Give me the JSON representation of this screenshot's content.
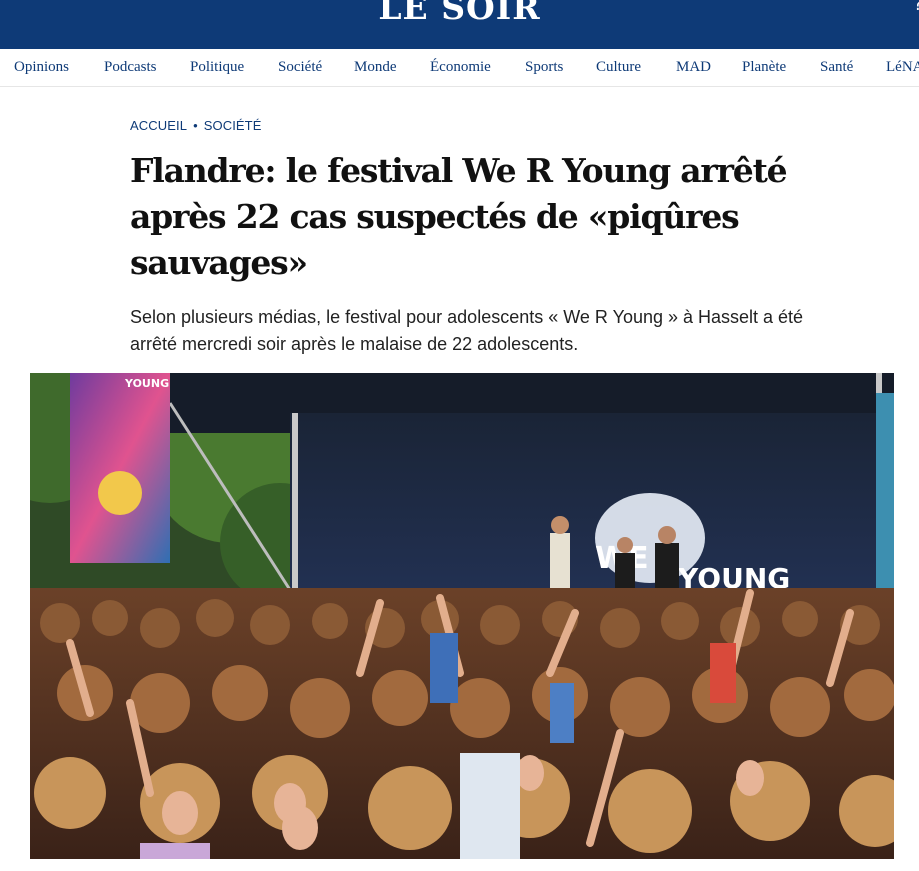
{
  "header": {
    "logo": "LE SOIR"
  },
  "nav": {
    "items": [
      "Opinions",
      "Podcasts",
      "Politique",
      "Société",
      "Monde",
      "Économie",
      "Sports",
      "Culture",
      "MAD",
      "Planète",
      "Santé",
      "LéNA"
    ]
  },
  "breadcrumb": {
    "home": "ACCUEIL",
    "section": "SOCIÉTÉ"
  },
  "article": {
    "title_line1": "Flandre: le festival We R Young arrêté",
    "title_line2": "après 22 cas suspectés de «piqûres",
    "title_line3": "sauvages»",
    "lead_line1": "Selon plusieurs médias, le festival pour adolescents « We R Young » à Hasselt a été",
    "lead_line2": "arrêté mercredi soir après le malaise de 22 adolescents."
  },
  "hero_image": {
    "stage_banner_1": "WE",
    "stage_banner_2": "YOUNG",
    "side_banner": "YOUNG"
  }
}
